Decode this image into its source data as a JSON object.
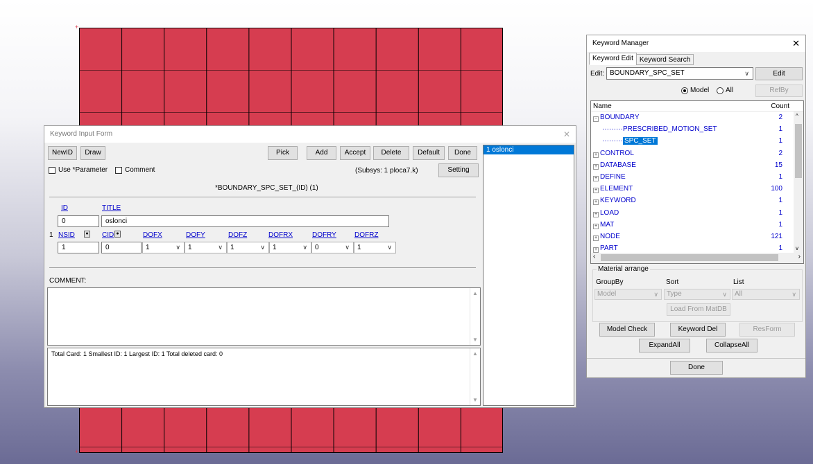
{
  "canvas": {
    "mesh_color": "#d63d50",
    "axis_marks": [
      "+",
      "+"
    ]
  },
  "kif": {
    "title": "Keyword Input Form",
    "buttons": {
      "newid": "NewID",
      "draw": "Draw",
      "pick": "Pick",
      "add": "Add",
      "accept": "Accept",
      "delete": "Delete",
      "default": "Default",
      "done": "Done",
      "setting": "Setting"
    },
    "use_parameter": "Use *Parameter",
    "comment_check": "Comment",
    "subsys": "(Subsys: 1 ploca7.k)",
    "keyword_header": "*BOUNDARY_SPC_SET_(ID)  (1)",
    "card1": {
      "id_label": "ID",
      "title_label": "TITLE",
      "id_value": "0",
      "title_value": "oslonci"
    },
    "card2": {
      "row_number": "1",
      "labels": [
        "NSID",
        "CID",
        "DOFX",
        "DOFY",
        "DOFZ",
        "DOFRX",
        "DOFRY",
        "DOFRZ"
      ],
      "nsid": "1",
      "cid": "0",
      "dofs": [
        "1",
        "1",
        "1",
        "1",
        "0",
        "1"
      ]
    },
    "comment_label": "COMMENT:",
    "status": "Total Card: 1   Smallest ID: 1   Largest ID: 1   Total deleted card: 0",
    "list_items": [
      "1  oslonci"
    ]
  },
  "km": {
    "title": "Keyword Manager",
    "tabs": [
      "Keyword Edit",
      "Keyword Search"
    ],
    "edit_label": "Edit:",
    "edit_value": "BOUNDARY_SPC_SET",
    "edit_button": "Edit",
    "radio_model": "Model",
    "radio_all": "All",
    "refby": "RefBy",
    "tree_headers": {
      "name": "Name",
      "count": "Count"
    },
    "tree_rows": [
      {
        "name": "BOUNDARY",
        "count": "2",
        "expanded": true
      },
      {
        "name": "PRESCRIBED_MOTION_SET",
        "count": "1",
        "child": true
      },
      {
        "name": "SPC_SET",
        "count": "1",
        "child": true,
        "selected": true
      },
      {
        "name": "CONTROL",
        "count": "2"
      },
      {
        "name": "DATABASE",
        "count": "15"
      },
      {
        "name": "DEFINE",
        "count": "1"
      },
      {
        "name": "ELEMENT",
        "count": "100"
      },
      {
        "name": "KEYWORD",
        "count": "1"
      },
      {
        "name": "LOAD",
        "count": "1"
      },
      {
        "name": "MAT",
        "count": "1"
      },
      {
        "name": "NODE",
        "count": "121"
      },
      {
        "name": "PART",
        "count": "1"
      }
    ],
    "material": {
      "title": "Material arrange",
      "groupby_label": "GroupBy",
      "sort_label": "Sort",
      "list_label": "List",
      "groupby_value": "Model",
      "sort_value": "Type",
      "list_value": "All",
      "load_button": "Load From MatDB"
    },
    "buttons": {
      "model_check": "Model Check",
      "keyword_del": "Keyword Del",
      "resform": "ResForm",
      "expand_all": "ExpandAll",
      "collapse_all": "CollapseAll",
      "done": "Done"
    }
  }
}
